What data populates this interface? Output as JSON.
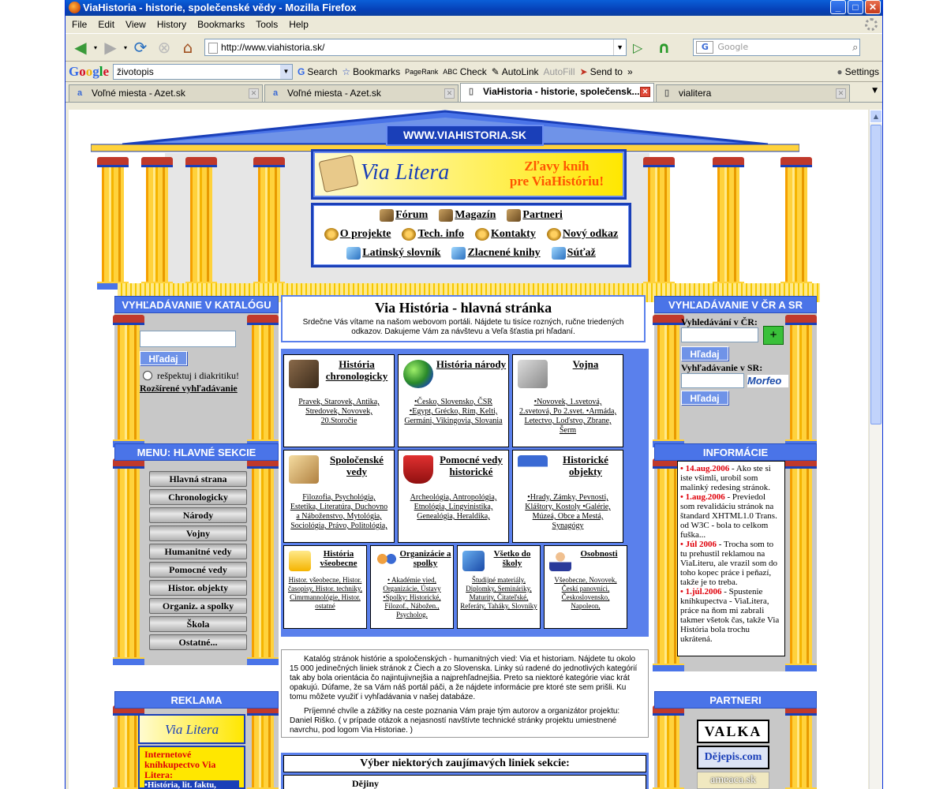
{
  "window": {
    "title": "ViaHistoria - historie, společenské vědy - Mozilla Firefox",
    "controls": {
      "minimize": "_",
      "maximize": "□",
      "close": "✕"
    }
  },
  "menu": [
    "File",
    "Edit",
    "View",
    "History",
    "Bookmarks",
    "Tools",
    "Help"
  ],
  "nav": {
    "url": "http://www.viahistoria.sk/",
    "search_placeholder": "Google"
  },
  "google_toolbar": {
    "query": "životopis",
    "search_label": "Search",
    "bookmarks_label": "Bookmarks",
    "pagerank_label": "PageRank",
    "check_label": "Check",
    "autolink_label": "AutoLink",
    "autofill_label": "AutoFill",
    "sendto_label": "Send to",
    "more_label": "»",
    "settings_label": "Settings"
  },
  "tabs": [
    {
      "label": "Voľné miesta - Azet.sk",
      "active": false
    },
    {
      "label": "Voľné miesta - Azet.sk",
      "active": false
    },
    {
      "label": "ViaHistoria - historie, společensk...",
      "active": true
    },
    {
      "label": "vialitera",
      "active": false
    }
  ],
  "page": {
    "site_name": "WWW.VIAHISTORIA.SK",
    "banner": {
      "logo": "Via Litera",
      "promo_line1": "Zľavy kníh",
      "promo_line2": "pre ViaHistóriu!"
    },
    "top_nav": [
      [
        "Fórum",
        "Magazín",
        "Partneri"
      ],
      [
        "O projekte",
        "Tech. info",
        "Kontakty",
        "Nový odkaz"
      ],
      [
        "Latinský slovník",
        "Zlacnené knihy",
        "Súťaž"
      ]
    ],
    "left_search": {
      "header": "VYHĽADÁVANIE V KATALÓGU",
      "button": "Hľadaj",
      "checkbox_label": "rešpektuj i diakritiku!",
      "advanced_link": "Rozšírené vyhľadávanie"
    },
    "left_menu": {
      "header": "MENU: HLAVNÉ SEKCIE",
      "items": [
        "Hlavná strana",
        "Chronologicky",
        "Národy",
        "Vojny",
        "Humanitné vedy",
        "Pomocné vedy",
        "Histor. objekty",
        "Organiz. a spolky",
        "Škola",
        "Ostatné..."
      ]
    },
    "left_ad": {
      "header": "REKLAMA",
      "logo": "Via Litera",
      "text": "Internetové kníhkupectvo Via Litera:",
      "bullet": "•História, lit. faktu,"
    },
    "main": {
      "title": "Via História - hlavná stránka",
      "welcome": "Srdečne Vás vítame na našom webovom portáli. Nájdete tu tisíce rozných, ručne triedených odkazov. Dakujeme Vám za návštevu a Veľa šťastia pri hľadaní.",
      "categories": [
        {
          "title": "História chronologicky",
          "links": "Pravek, Starovek, Antika, Stredovek, Novovek, 20.Storočie",
          "icon": "book-icon"
        },
        {
          "title": "História národy",
          "links": "•Česko, Slovensko, ČSR •Egypt, Grécko, Rím, Kelti, Germáni, Vikingovia, Slovania",
          "icon": "globe-icon"
        },
        {
          "title": "Vojna",
          "links": "•Novovek, 1.svetová, 2.svetová, Po 2.svet. •Armáda, Letectvo, Loďstvo, Zbrane, Šerm",
          "icon": "swords-icon"
        },
        {
          "title": "Spoločenské vedy",
          "links": "Filozofia, Psychológia, Estetika, Literatúra, Duchovno a Náboženstvo, Mytológia, Sociológia, Právo, Politológia,",
          "icon": "scroll-icon"
        },
        {
          "title": "Pomocné vedy historické",
          "links": "Archeológia, Antropológia, Etnológia, Lingvinistika, Genealógia, Heraldika,",
          "icon": "shield-icon"
        },
        {
          "title": "Historické objekty",
          "links": "•Hrady, Zámky, Pevnosti, Kláštory, Kostoly •Galérie, Múzeá, Obce a Mestá, Synagógy",
          "icon": "house-icon"
        },
        {
          "title": "História všeobecne",
          "links": "Histor. všeobecne, Histor. časopisy, Histor. techniky, Cimrmannológie, Histor. ostatné",
          "icon": "folder-icon"
        },
        {
          "title": "Organizácie a spolky",
          "links": "• Akadémie vied, Organizácie, Ústavy •Spolky: Historické, Filozof., Nábožen., Psycholog.",
          "icon": "people-icon"
        },
        {
          "title": "Všetko do školy",
          "links": "Študijné materiály, Diplomky, Semináriky, Maturity, Čitateľské, Referáty, Taháky, Slovníky",
          "icon": "books-icon"
        },
        {
          "title": "Osobnosti",
          "links": "Všeobecne, Novovek, Českí panovníci, Československo, Napoleon,",
          "icon": "person-icon"
        }
      ],
      "intro_p1": "Katalóg stránok histórie a spoločenských - humanitných vied: Via et historiam. Nájdete tu okolo 15 000 jedinečných liniek stránok z Čiech a zo Slovenska. Linky sú radené do jednotlivých kategórií tak aby bola orientácia čo najintujivnejšia a najprehľadnejšia. Preto sa niektoré kategórie viac krát opakujú. Dúfame, že sa Vám náš portál páči, a že nájdete informácie pre ktoré ste sem prišli. Ku tomu môžete využiť i vyhľadávania v našej databáze.",
      "intro_p2": "Príjemné chvíle a zážitky na ceste poznania Vám praje tým autorov a organizátor projektu: Daniel Riško. ( v prípade otázok a nejasností navštívte technické stránky projektu umiestnené navrchu, pod logom Via Historiae. )",
      "selected_title": "Výber niektorých zaujímavých liniek sekcie:",
      "selected_first": "Dějiny"
    },
    "right_search": {
      "header": "VYHĽADÁVANIE V ČR A SR",
      "cz_label": "Vyhledávání v ČR:",
      "sk_label": "Vyhľadávanie v SR:",
      "button": "Hľadaj",
      "morfeo": "Morfeo"
    },
    "news": {
      "header": "INFORMÁCIE",
      "items": [
        {
          "date": "• 14.aug.2006",
          "text": " - Ako ste si iste všimli, urobil som malinký redesing stránok."
        },
        {
          "date": "• 1.aug.2006",
          "text": " - Previedol som revalidáciu stránok na štandard XHTML1.0 Trans. od W3C - bola to celkom fuška..."
        },
        {
          "date": "• Júl 2006",
          "text": " - Trocha som to tu prehustil reklamou na ViaLiteru, ale vrazil som do toho kopec práce i peňazí, takže je to treba."
        },
        {
          "date": "• 1.júl.2006",
          "text": " - Spustenie kníhkupectva - ViaLitera, práce na ňom mi zabrali takmer všetok čas, takže Via História bola trochu ukrátená."
        }
      ]
    },
    "partners": {
      "header": "PARTNERI",
      "logos": [
        "VALKA",
        "Dějepis.com",
        "ameaca.sk"
      ]
    }
  },
  "colors": {
    "accent_blue": "#4a74e8",
    "dark_blue": "#1a3fb8",
    "gold": "#ffd23c",
    "news_red": "#e0000a"
  }
}
